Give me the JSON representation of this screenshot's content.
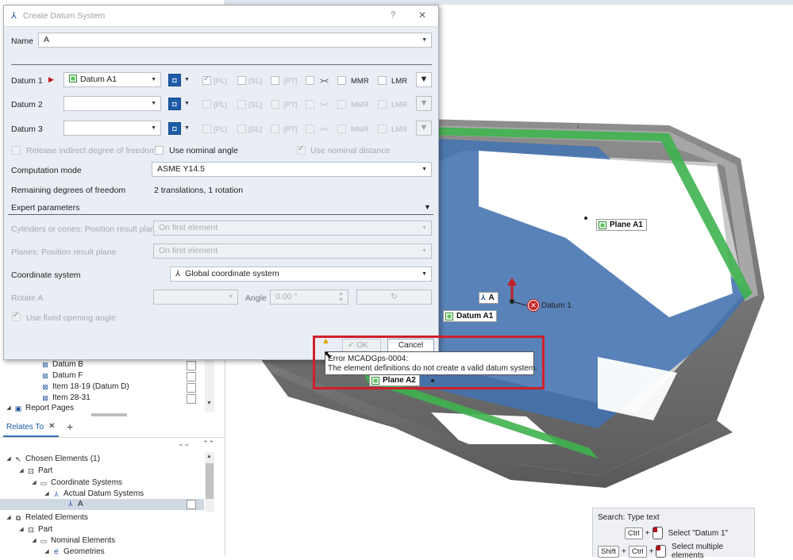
{
  "dialog": {
    "title": "Create Datum System",
    "help_glyph": "?",
    "close_glyph": "✕",
    "name_label": "Name",
    "name_value": "A",
    "datums": [
      {
        "label": "Datum 1",
        "value": "Datum A1"
      },
      {
        "label": "Datum 2",
        "value": ""
      },
      {
        "label": "Datum 3",
        "value": ""
      }
    ],
    "toggles": {
      "pl": "[PL]",
      "sl": "[SL]",
      "pt": "[PT]",
      "slide": "><",
      "mmr": "MMR",
      "lmr": "LMR"
    },
    "release_label": "Release indirect degree of freedom",
    "use_nominal_angle_label": "Use nominal angle",
    "use_nominal_distance_label": "Use nominal distance",
    "computation_mode_label": "Computation mode",
    "computation_mode_value": "ASME Y14.5",
    "remaining_dof_label": "Remaining degrees of freedom",
    "remaining_dof_value": "2 translations, 1 rotation",
    "expert_label": "Expert parameters",
    "cylinders_label": "Cylinders or cones: Position result plane",
    "cylinders_value": "On first element",
    "planes_label": "Planes: Position result plane",
    "planes_value": "On first element",
    "coord_label": "Coordinate system",
    "coord_value": "Global coordinate system",
    "rotate_label": "Rotate A",
    "angle_label": "Angle",
    "angle_value": "0.00 °",
    "fixed_opening_label": "Use fixed opening angle",
    "ok_label": "OK",
    "cancel_label": "Cancel"
  },
  "error_tooltip": {
    "line1": "Error MCADGps-0004:",
    "line2": "The element definitions do not create a valid datum system."
  },
  "explorer": {
    "items": [
      "Datum B",
      "Datum F",
      "Item 18-19 (Datum D)",
      "Item 28-31"
    ],
    "report_pages": "Report Pages",
    "relates_tab": "Relates To",
    "close_glyph": "✕",
    "add_glyph": "+",
    "chosen_elements": "Chosen Elements (1)",
    "part": "Part",
    "coordinate_systems": "Coordinate Systems",
    "actual_datum_systems": "Actual Datum Systems",
    "selected_item": "A",
    "related_elements": "Related Elements",
    "part2": "Part",
    "nominal_elements": "Nominal Elements",
    "geometries": "Geometries"
  },
  "viewport": {
    "plane_a1": "Plane A1",
    "plane_a2": "Plane A2",
    "datum_a1": "Datum A1",
    "a_label": "A",
    "datum_1": "Datum 1",
    "error_mark": "✕"
  },
  "hint": {
    "search": "Search: Type text",
    "ctrl": "Ctrl",
    "shift": "Shift",
    "plus": "+",
    "select_datum": "Select \"Datum 1\"",
    "select_multiple": "Select multiple elements"
  },
  "colors": {
    "accent": "#1e5ca8",
    "error_red": "#d0202a",
    "green": "#2e8b2e"
  }
}
